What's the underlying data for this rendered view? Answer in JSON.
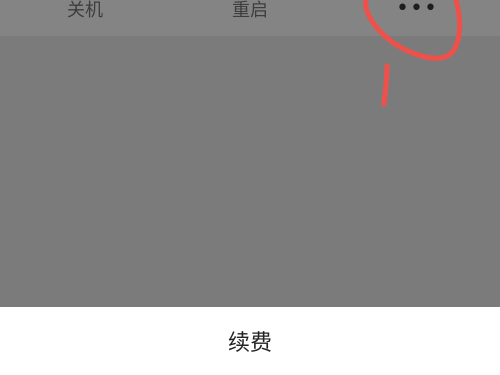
{
  "toolbar": {
    "shutdown_label": "关机",
    "restart_label": "重启",
    "more_label": "•••"
  },
  "sheet": {
    "renew_label": "续费"
  },
  "colors": {
    "overlay": "#7b7b7b",
    "toolbar": "#848484",
    "sheet": "#ffffff",
    "annotation": "#f0504a"
  },
  "icons": {
    "more": "more-options-icon"
  }
}
